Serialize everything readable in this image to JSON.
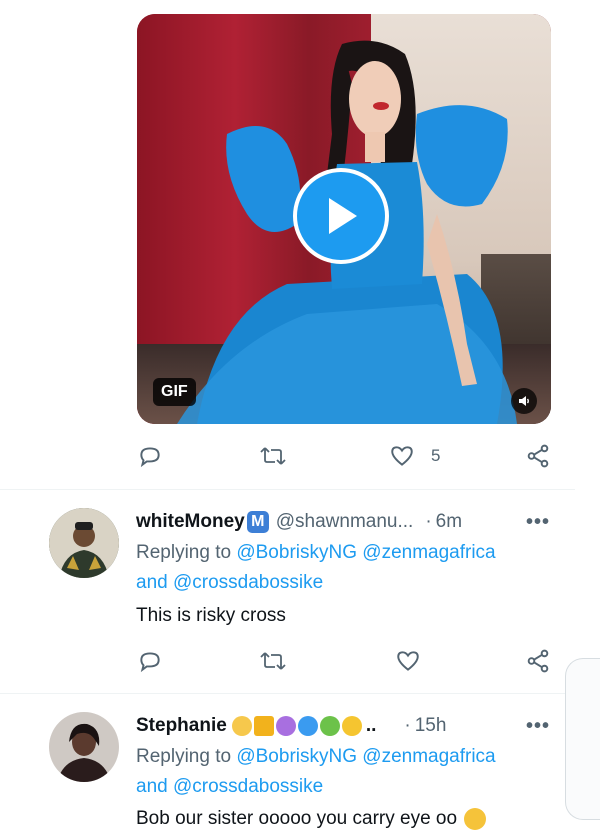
{
  "media": {
    "gif_label": "GIF",
    "play_icon": "play-icon",
    "sound_icon": "speaker-icon"
  },
  "tweet1_actions": {
    "reply_icon": "reply-icon",
    "retweet_icon": "retweet-icon",
    "like_icon": "heart-icon",
    "like_count": "5",
    "share_icon": "share-icon"
  },
  "replies": [
    {
      "name": "whiteMoney",
      "badge": "M",
      "handle": "@shawnmanu...",
      "sep": "·",
      "time": "6m",
      "more": "•••",
      "replying_prefix": "Replying to",
      "mention1": "@BobriskyNG",
      "mention2": "@zenmagafrica",
      "and": "and",
      "mention3": "@crossdabossike",
      "text": "This is risky cross",
      "like_count": ""
    },
    {
      "name": "Stephanie",
      "emoji_trail": "..",
      "sep": "·",
      "time": "15h",
      "more": "•••",
      "replying_prefix": "Replying to",
      "mention1": "@BobriskyNG",
      "mention2": "@zenmagafrica",
      "and": "and",
      "mention3": "@crossdabossike",
      "text": "Bob our sister ooooo you carry eye oo"
    }
  ],
  "colors": {
    "accent": "#1d9bf0",
    "muted": "#536471",
    "text": "#0f1419"
  }
}
